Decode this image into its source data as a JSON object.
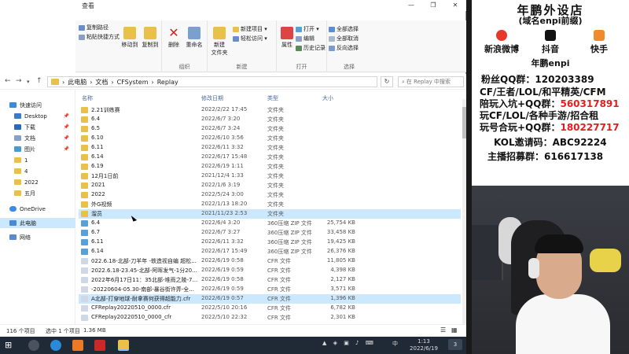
{
  "window": {
    "title": "查看",
    "controls": [
      "—",
      "❐",
      "✕"
    ]
  },
  "ribbon": {
    "clipboard": {
      "copy_path": "复制路径",
      "paste_shortcut": "粘贴快捷方式",
      "move_to": "移动到",
      "copy_to": "复制到",
      "label": ""
    },
    "organize": {
      "delete": "删除",
      "rename": "重命名",
      "label": "组织"
    },
    "new": {
      "new_folder": "新建\n文件夹",
      "new_item": "新建项目 ▾",
      "easy_access": "轻松访问 ▾",
      "label": "新建"
    },
    "open": {
      "properties": "属性",
      "open": "打开 ▾",
      "edit": "编辑",
      "history": "历史记录",
      "label": "打开"
    },
    "select": {
      "select_all": "全部选择",
      "select_none": "全部取消",
      "invert": "反向选择",
      "label": "选择"
    }
  },
  "address": {
    "segments": [
      "此电脑",
      "文档",
      "CFSystem",
      "Replay"
    ],
    "separator": "›",
    "search_placeholder": "在 Replay 中搜索"
  },
  "navpane": {
    "items": [
      {
        "label": "快速访问",
        "icon": "star-icon",
        "pinned": false
      },
      {
        "label": "Desktop",
        "icon": "desktop-icon",
        "pinned": true
      },
      {
        "label": "下载",
        "icon": "download-icon",
        "pinned": true
      },
      {
        "label": "文档",
        "icon": "document-icon",
        "pinned": true
      },
      {
        "label": "图片",
        "icon": "picture-icon",
        "pinned": true
      },
      {
        "label": "1",
        "icon": "folder-icon",
        "pinned": false
      },
      {
        "label": "4",
        "icon": "folder-icon",
        "pinned": false
      },
      {
        "label": "2022",
        "icon": "folder-icon",
        "pinned": false
      },
      {
        "label": "五月",
        "icon": "folder-icon",
        "pinned": false
      },
      {
        "label": "OneDrive",
        "icon": "cloud-icon",
        "pinned": false
      },
      {
        "label": "此电脑",
        "icon": "computer-icon",
        "pinned": false
      },
      {
        "label": "网络",
        "icon": "network-icon",
        "pinned": false
      }
    ],
    "pin_glyph": "📌"
  },
  "columns": {
    "name": "名称",
    "date": "修改日期",
    "type": "类型",
    "size": "大小"
  },
  "files": [
    {
      "name": "2.21训练赛",
      "date": "2022/2/22 17:45",
      "type": "文件夹",
      "size": "",
      "kind": "folder"
    },
    {
      "name": "6.4",
      "date": "2022/6/7 3:20",
      "type": "文件夹",
      "size": "",
      "kind": "folder"
    },
    {
      "name": "6.5",
      "date": "2022/6/7 3:24",
      "type": "文件夹",
      "size": "",
      "kind": "folder"
    },
    {
      "name": "6.10",
      "date": "2022/6/10 3:56",
      "type": "文件夹",
      "size": "",
      "kind": "folder"
    },
    {
      "name": "6.11",
      "date": "2022/6/11 3:32",
      "type": "文件夹",
      "size": "",
      "kind": "folder"
    },
    {
      "name": "6.14",
      "date": "2022/6/17 15:48",
      "type": "文件夹",
      "size": "",
      "kind": "folder"
    },
    {
      "name": "6.19",
      "date": "2022/6/19 1:11",
      "type": "文件夹",
      "size": "",
      "kind": "folder"
    },
    {
      "name": "12月1日前",
      "date": "2021/12/4 1:33",
      "type": "文件夹",
      "size": "",
      "kind": "folder"
    },
    {
      "name": "2021",
      "date": "2022/1/6 3:19",
      "type": "文件夹",
      "size": "",
      "kind": "folder"
    },
    {
      "name": "2022",
      "date": "2022/5/24 3:00",
      "type": "文件夹",
      "size": "",
      "kind": "folder"
    },
    {
      "name": "外G视频",
      "date": "2022/1/13 18:20",
      "type": "文件夹",
      "size": "",
      "kind": "folder"
    },
    {
      "name": "溜员",
      "date": "2021/11/23 2:53",
      "type": "文件夹",
      "size": "",
      "kind": "folder",
      "highlighted": true
    },
    {
      "name": "6.4",
      "date": "2022/6/4 3:20",
      "type": "360压缩 ZIP 文件",
      "size": "25,754 KB",
      "kind": "zip"
    },
    {
      "name": "6.7",
      "date": "2022/6/7 3:27",
      "type": "360压缩 ZIP 文件",
      "size": "33,458 KB",
      "kind": "zip"
    },
    {
      "name": "6.11",
      "date": "2022/6/11 3:32",
      "type": "360压缩 ZIP 文件",
      "size": "19,425 KB",
      "kind": "zip"
    },
    {
      "name": "6.14",
      "date": "2022/6/17 15:49",
      "type": "360压缩 ZIP 文件",
      "size": "26,376 KB",
      "kind": "zip"
    },
    {
      "name": "022.6.18-北部-刀羊年 -轶造视自编 超松...",
      "date": "2022/6/19 0:58",
      "type": "CFR 文件",
      "size": "11,805 KB",
      "kind": "cfr"
    },
    {
      "name": "2022.6.18-23.45-北部-阿晖发气-1分20...",
      "date": "2022/6/19 0:59",
      "type": "CFR 文件",
      "size": "4,398 KB",
      "kind": "cfr"
    },
    {
      "name": "2022年6月17日11：35北部-堆雨之陵-7...",
      "date": "2022/6/19 0:58",
      "type": "CFR 文件",
      "size": "2,127 KB",
      "kind": "cfr"
    },
    {
      "name": "-20220604-05.30-南部-暴谷街许弄-全...",
      "date": "2022/6/19 0:59",
      "type": "CFR 文件",
      "size": "3,571 KB",
      "kind": "cfr"
    },
    {
      "name": "A北部-打穿地球-耐拿赛何获得超能力.cfr",
      "date": "2022/6/19 0:57",
      "type": "CFR 文件",
      "size": "1,396 KB",
      "kind": "cfr",
      "selected": true
    },
    {
      "name": "CFReplay20220510_0000.cfr",
      "date": "2022/5/10 20:16",
      "type": "CFR 文件",
      "size": "6,782 KB",
      "kind": "cfr"
    },
    {
      "name": "CFReplay20220510_0000_cfr",
      "date": "2022/5/10 22:32",
      "type": "CFR 文件",
      "size": "2,301 KB",
      "kind": "cfr"
    }
  ],
  "status": {
    "count": "116 个项目",
    "selected": "选中 1 个项目",
    "size": "1.36 MB"
  },
  "taskbar": {
    "time": "1:13",
    "date": "2022/6/19",
    "tray_text": "中",
    "notify": "3"
  },
  "promo": {
    "title": "年鹏外设店",
    "subtitle": "(域名enpi前缀)",
    "weibo": "新浪微博",
    "douyin": "抖音",
    "kuaishou": "快手",
    "brand": "年鹏enpi",
    "line1": "粉丝QQ群：120203389",
    "line2": "CF/王者/LOL/和平精英/CFM",
    "line3_label": "陪玩入坑+QQ群：",
    "line3_value": "560317891",
    "line4": "玩CF/LOL/各种手游/招合租",
    "line5_label": "玩号合玩+QQ群：",
    "line5_value": "180227717",
    "kol": "KOL邀请码：ABC92224",
    "recruit": "主播招募群：616617138"
  },
  "colors": {
    "folder": "#e8c04a",
    "zip": "#5aa0d8",
    "cfr": "#cfd8e4",
    "selection": "#cce8ff",
    "highlight_red": "#e02020"
  }
}
